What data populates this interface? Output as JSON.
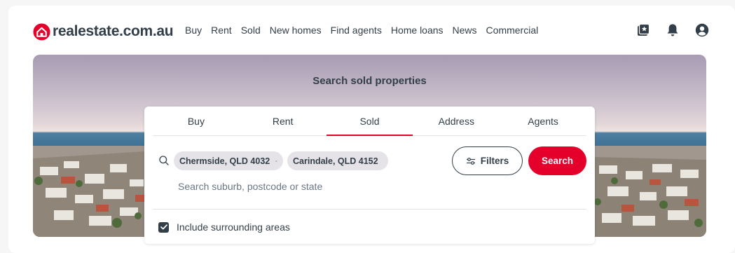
{
  "brand": {
    "name": "realestate.com.au",
    "accent": "#e4002b",
    "text": "#333f48"
  },
  "nav": {
    "items": [
      "Buy",
      "Rent",
      "Sold",
      "New homes",
      "Find agents",
      "Home loans",
      "News",
      "Commercial"
    ]
  },
  "header_icons": [
    "saved-properties-icon",
    "notifications-bell-icon",
    "account-user-icon"
  ],
  "hero": {
    "title": "Search sold properties"
  },
  "search": {
    "tabs": [
      {
        "label": "Buy",
        "active": false
      },
      {
        "label": "Rent",
        "active": false
      },
      {
        "label": "Sold",
        "active": true
      },
      {
        "label": "Address",
        "active": false
      },
      {
        "label": "Agents",
        "active": false
      }
    ],
    "chips": [
      "Chermside, QLD 4032",
      "Carindale, QLD 4152"
    ],
    "placeholder": "Search suburb, postcode or state",
    "filters_label": "Filters",
    "search_label": "Search",
    "include_surrounding": {
      "label": "Include surrounding areas",
      "checked": true
    }
  }
}
